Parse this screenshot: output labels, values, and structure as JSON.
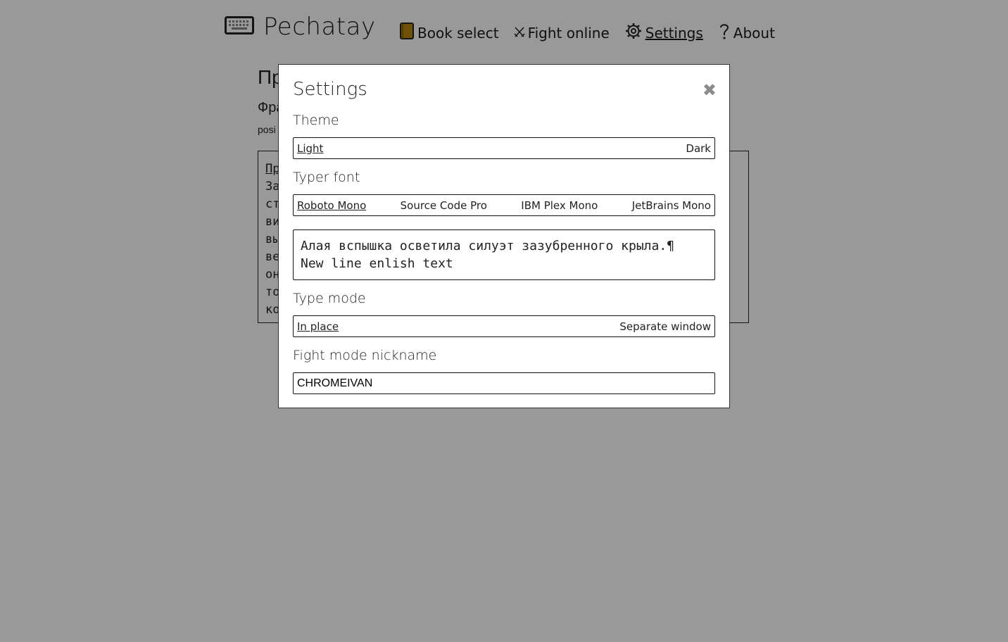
{
  "app": {
    "title": "Pechatay"
  },
  "nav": {
    "items": [
      {
        "label": "Book select",
        "icon": "book-icon"
      },
      {
        "label": "Fight online",
        "icon": "crossed-swords-icon"
      },
      {
        "label": "Settings",
        "icon": "gear-icon",
        "active": true
      },
      {
        "label": "About",
        "icon": "question-icon"
      }
    ]
  },
  "background": {
    "title_fragment": "Пр",
    "subtitle_fragment": "Фра",
    "meta_fragment": "posi",
    "lines": [
      "Пр",
      "За",
      "ст",
      "ви",
      "вы",
      "ве",
      "он",
      "то",
      "ко"
    ]
  },
  "modal": {
    "title": "Settings",
    "close_glyph": "✖",
    "theme": {
      "label": "Theme",
      "options": [
        "Light",
        "Dark"
      ],
      "selected": "Light"
    },
    "typer_font": {
      "label": "Typer font",
      "options": [
        "Roboto Mono",
        "Source Code Pro",
        "IBM Plex Mono",
        "JetBrains Mono"
      ],
      "selected": "Roboto Mono"
    },
    "preview": {
      "line1": "Алая вспышка осветила силуэт зазубренного крыла.¶",
      "line2": "New line enlish text"
    },
    "type_mode": {
      "label": "Type mode",
      "options": [
        "In place",
        "Separate window"
      ],
      "selected": "In place"
    },
    "nickname": {
      "label": "Fight mode nickname",
      "value": "CHROMEIVAN"
    }
  },
  "colors": {
    "overlay": "rgba(0,0,0,0.40)",
    "book_icon_fill": "#d4a017",
    "close_icon": "#8c8c8c"
  }
}
